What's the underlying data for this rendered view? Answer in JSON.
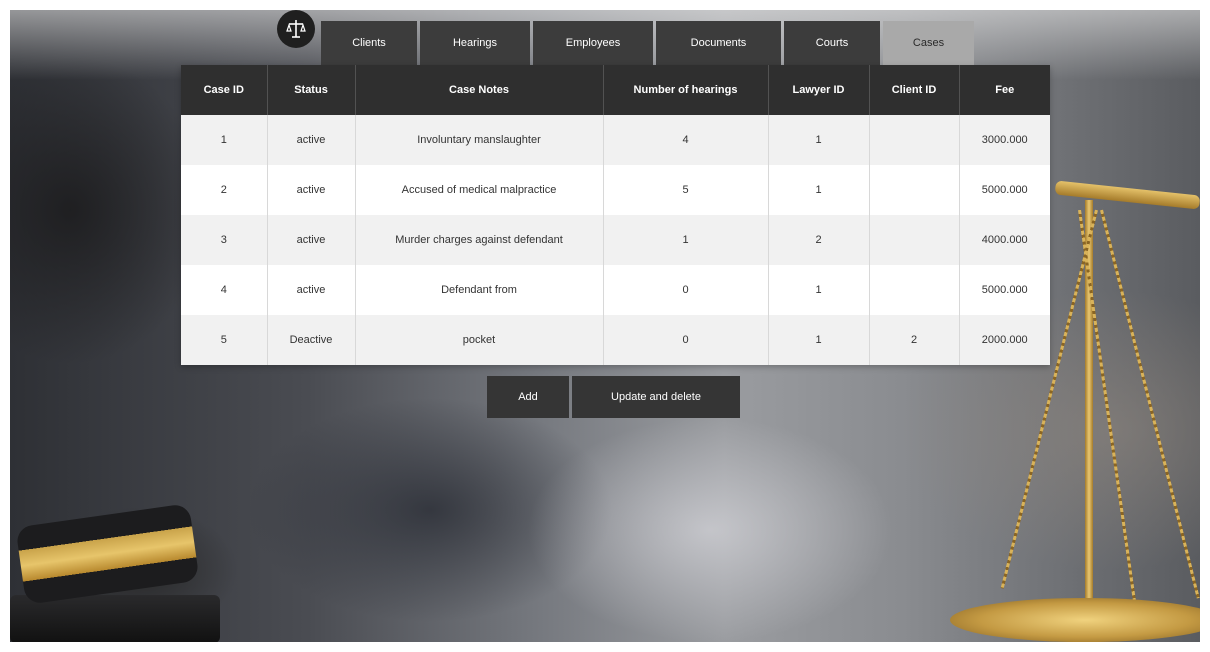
{
  "nav": {
    "tabs": [
      {
        "label": "Clients"
      },
      {
        "label": "Hearings"
      },
      {
        "label": "Employees"
      },
      {
        "label": "Documents"
      },
      {
        "label": "Courts"
      },
      {
        "label": "Cases"
      }
    ],
    "active_tab": "Cases"
  },
  "cases_table": {
    "columns": [
      "Case ID",
      "Status",
      "Case Notes",
      "Number of hearings",
      "Lawyer ID",
      "Client ID",
      "Fee"
    ],
    "rows": [
      {
        "case_id": "1",
        "status": "active",
        "notes": "Involuntary manslaughter",
        "hearings": "4",
        "lawyer_id": "1",
        "client_id": "",
        "fee": "3000.000"
      },
      {
        "case_id": "2",
        "status": "active",
        "notes": "Accused of medical malpractice",
        "hearings": "5",
        "lawyer_id": "1",
        "client_id": "",
        "fee": "5000.000"
      },
      {
        "case_id": "3",
        "status": "active",
        "notes": "Murder charges against defendant",
        "hearings": "1",
        "lawyer_id": "2",
        "client_id": "",
        "fee": "4000.000"
      },
      {
        "case_id": "4",
        "status": "active",
        "notes": "Defendant from",
        "hearings": "0",
        "lawyer_id": "1",
        "client_id": "",
        "fee": "5000.000"
      },
      {
        "case_id": "5",
        "status": "Deactive",
        "notes": "pocket",
        "hearings": "0",
        "lawyer_id": "1",
        "client_id": "2",
        "fee": "2000.000"
      }
    ]
  },
  "actions": {
    "add_label": "Add",
    "update_delete_label": "Update and delete"
  },
  "colors": {
    "header_bg": "#2f2f2f",
    "tab_bg": "#3c3c3c",
    "tab_active_bg": "#a9a9a9",
    "row_alt_bg": "#f1f1f1"
  },
  "icons": {
    "logo": "scales-of-justice-icon"
  }
}
